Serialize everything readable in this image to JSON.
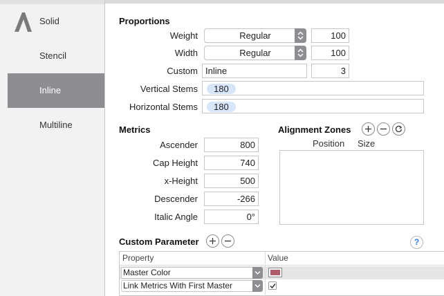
{
  "sidebar": {
    "items": [
      {
        "label": "Solid",
        "icon": "font-a-icon",
        "selected": false
      },
      {
        "label": "Stencil",
        "selected": false
      },
      {
        "label": "Inline",
        "selected": true
      },
      {
        "label": "Multiline",
        "selected": false
      }
    ]
  },
  "proportions": {
    "title": "Proportions",
    "weight": {
      "label": "Weight",
      "popup": "Regular",
      "value": "100"
    },
    "width": {
      "label": "Width",
      "popup": "Regular",
      "value": "100"
    },
    "custom": {
      "label": "Custom",
      "name": "Inline",
      "value": "3"
    },
    "vertical_stems": {
      "label": "Vertical Stems",
      "token": "180"
    },
    "horizontal_stems": {
      "label": "Horizontal Stems",
      "token": "180"
    }
  },
  "metrics": {
    "title": "Metrics",
    "ascender": {
      "label": "Ascender",
      "value": "800"
    },
    "cap_height": {
      "label": "Cap Height",
      "value": "740"
    },
    "x_height": {
      "label": "x-Height",
      "value": "500"
    },
    "descender": {
      "label": "Descender",
      "value": "-266"
    },
    "italic_angle": {
      "label": "Italic Angle",
      "value": "0°"
    }
  },
  "alignment_zones": {
    "title": "Alignment Zones",
    "col_position": "Position",
    "col_size": "Size"
  },
  "custom_parameter": {
    "title": "Custom Parameter",
    "help": "?",
    "col_property": "Property",
    "col_value": "Value",
    "rows": [
      {
        "property": "Master Color",
        "value_type": "color",
        "color": "#b35a6b"
      },
      {
        "property": "Link Metrics With First Master",
        "value_type": "checkbox",
        "checked": true
      }
    ]
  },
  "colors": {
    "selection": "#8e8e92",
    "token_bg": "#d7e6fb",
    "help_blue": "#2a7ae2"
  }
}
